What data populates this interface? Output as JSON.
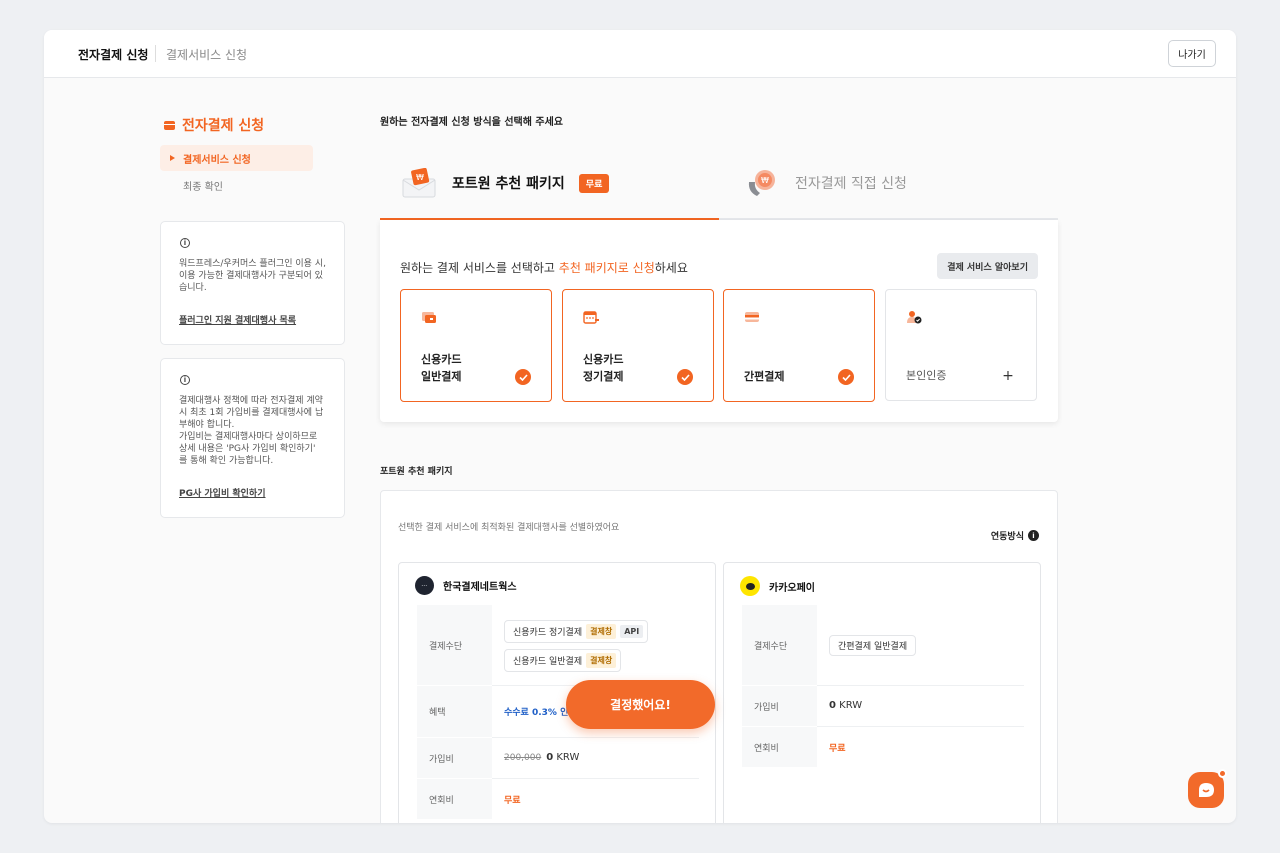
{
  "header": {
    "title": "전자결제 신청",
    "subtitle": "결제서비스 신청",
    "exit_label": "나가기"
  },
  "sidebar": {
    "heading": "전자결제 신청",
    "items": [
      {
        "label": "결제서비스 신청",
        "active": true
      },
      {
        "label": "최종 확인",
        "active": false
      }
    ],
    "info1": {
      "text": "워드프레스/우커머스 플러그인 이용 시, 이용 가능한 결제대행사가 구분되어 있습니다.",
      "link": "플러그인 지원 결제대행사 목록"
    },
    "info2": {
      "text1": "결제대행사 정책에 따라 전자결제 계약 시 최초 1회 가입비를 결제대행사에 납부해야 합니다.",
      "text2": "가입비는 결제대행사마다 상이하므로 상세 내용은 'PG사 가입비 확인하기' 를 통해 확인 가능합니다.",
      "link": "PG사 가입비 확인하기"
    }
  },
  "main": {
    "title": "원하는 전자결제 신청 방식을 선택해 주세요",
    "tabs": [
      {
        "label": "포트원 추천 패키지",
        "badge": "무료",
        "active": true
      },
      {
        "label": "전자결제 직접 신청",
        "active": false
      }
    ],
    "panel": {
      "heading_pre": "원하는 결제 서비스를 선택하고 ",
      "heading_highlight": "추천 패키지로 신청",
      "heading_post": "하세요",
      "learn_button": "결제 서비스 알아보기",
      "services": [
        {
          "line1": "신용카드",
          "line2": "일반결제",
          "selected": true,
          "icon": "card-icon"
        },
        {
          "line1": "신용카드",
          "line2": "정기결제",
          "selected": true,
          "icon": "calendar-icon"
        },
        {
          "line1": "",
          "line2": "간편결제",
          "selected": true,
          "icon": "wallet-icon"
        },
        {
          "line1": "",
          "line2": "본인인증",
          "selected": false,
          "icon": "user-check-icon"
        }
      ]
    },
    "package": {
      "section_title": "포트원 추천 패키지",
      "description": "선택한 결제 서비스에 최적화된 결제대행사를 선별하였어요",
      "link_mode": "연동방식",
      "pgs": [
        {
          "name": "한국결제네트웍스",
          "rows": {
            "method_label": "결제수단",
            "methods": [
              {
                "name": "신용카드 정기결제",
                "tags": [
                  "결제창",
                  "API"
                ]
              },
              {
                "name": "신용카드 일반결제",
                "tags": [
                  "결제창"
                ]
              }
            ],
            "benefit_label": "혜택",
            "benefit": "수수료 0.3% 인하",
            "fee_label": "가입비",
            "fee_original": "200,000",
            "fee_value": "0",
            "fee_unit": "KRW",
            "annual_label": "연회비",
            "annual_value": "무료"
          }
        },
        {
          "name": "카카오페이",
          "rows": {
            "method_label": "결제수단",
            "methods": [
              {
                "name": "간편결제 일반결제",
                "tags": []
              }
            ],
            "fee_label": "가입비",
            "fee_value": "0",
            "fee_unit": "KRW",
            "annual_label": "연회비",
            "annual_value": "무료"
          }
        }
      ]
    },
    "cta_label": "결정했어요!"
  },
  "colors": {
    "accent": "#f26522",
    "benefit": "#1f5fc7",
    "kakao": "#fee500"
  }
}
